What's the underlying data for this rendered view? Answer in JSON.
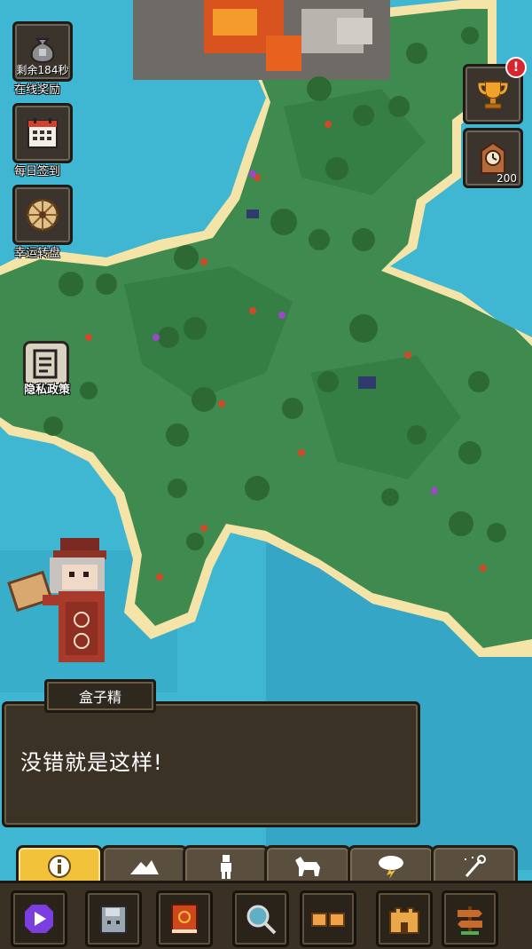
{
  "side_buttons": {
    "online_reward": {
      "timer": "剩余184秒",
      "label": "在线奖励",
      "icon": "moneybag-icon"
    },
    "daily_checkin": {
      "label": "每日签到",
      "icon": "calendar-icon"
    },
    "lucky_wheel": {
      "label": "幸运转盘",
      "icon": "wheel-icon"
    },
    "privacy": {
      "label": "隐私政策",
      "icon": "document-icon"
    }
  },
  "right_buttons": {
    "achievements": {
      "badge": "!",
      "icon": "trophy-icon"
    },
    "clock": {
      "count": "200",
      "icon": "clock-icon"
    }
  },
  "dialog": {
    "speaker": "盒子精",
    "text": "没错就是这样!"
  },
  "tabs": [
    {
      "icon": "info-icon",
      "active": true
    },
    {
      "icon": "mountain-icon",
      "active": false
    },
    {
      "icon": "human-icon",
      "active": false
    },
    {
      "icon": "animal-icon",
      "active": false
    },
    {
      "icon": "storm-icon",
      "active": false
    },
    {
      "icon": "magic-wand-icon",
      "active": false
    }
  ],
  "toolbar": [
    {
      "icon": "play-icon"
    },
    {
      "icon": "save-icon"
    },
    {
      "icon": "book-icon"
    },
    {
      "icon": "inspect-icon"
    },
    {
      "icon": "handshake-icon"
    },
    {
      "icon": "castle-icon"
    },
    {
      "icon": "signpost-icon"
    }
  ],
  "colors": {
    "ocean": "#3fb7d2",
    "land": "#3f8a4e",
    "sand": "#f4e4a8",
    "accent": "#f2c23a"
  }
}
